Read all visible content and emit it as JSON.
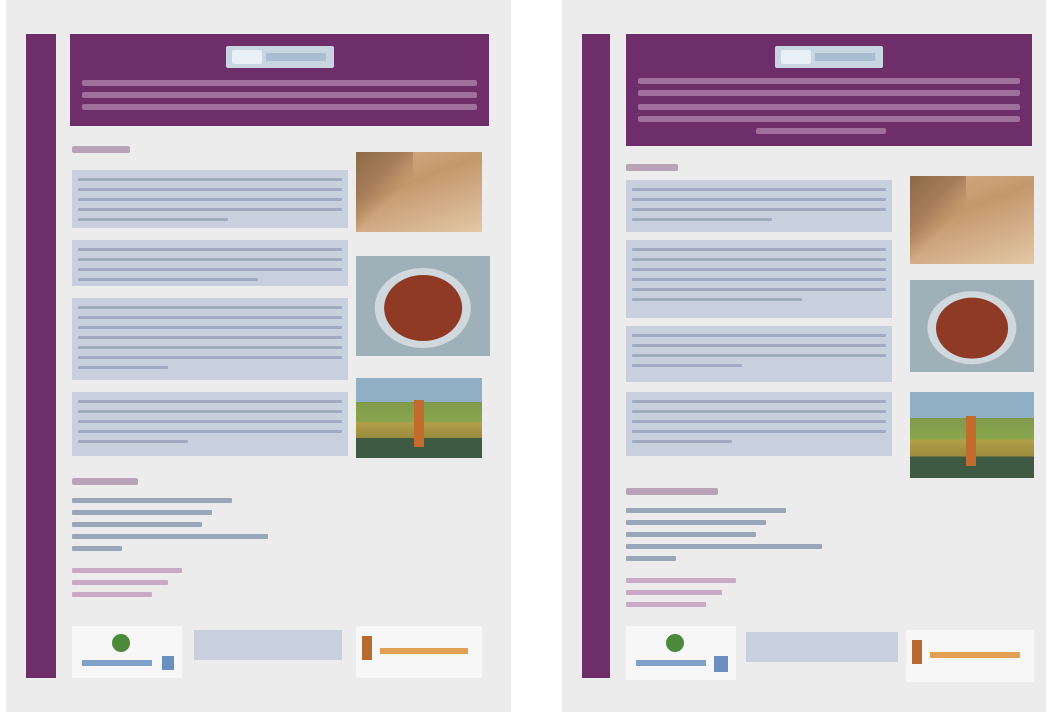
{
  "pages": [
    {
      "label": "left-page"
    },
    {
      "label": "right-page"
    }
  ],
  "photos": [
    "fabric-photo",
    "bowl-photo",
    "field-photo"
  ],
  "colors": {
    "brand_purple": "#6e2e6a",
    "page_background": "#ececec",
    "text_block": "#c8d0de"
  }
}
